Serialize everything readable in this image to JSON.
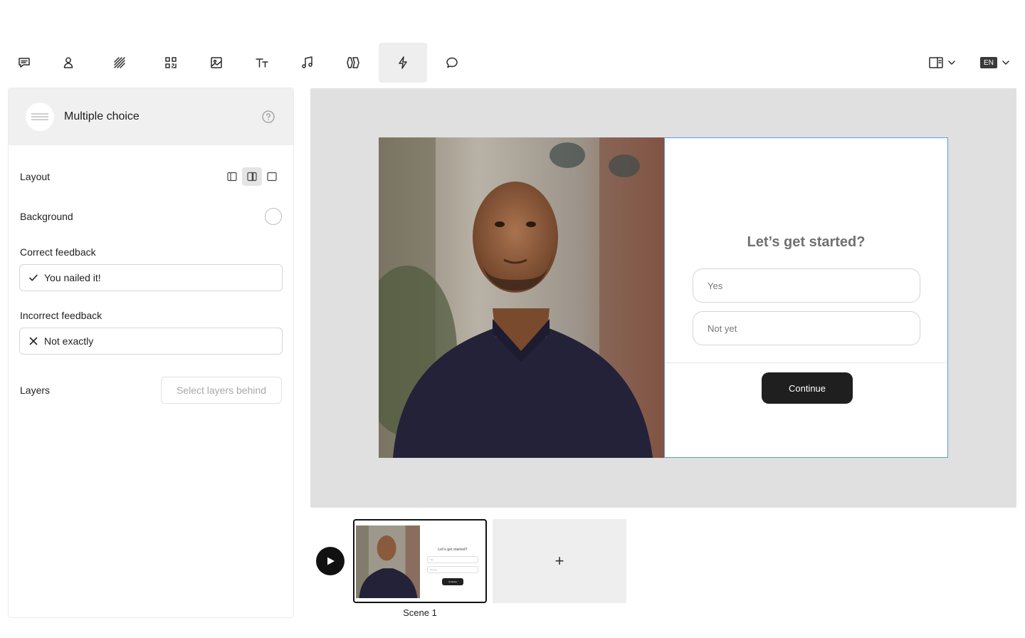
{
  "toolbar": {
    "tools": [
      "comment-lines-icon",
      "person-icon",
      "stripes-icon",
      "qr-code-icon",
      "image-icon",
      "text-size-icon",
      "music-note-icon",
      "chevrons-icon",
      "lightning-icon",
      "speech-bubble-icon"
    ],
    "active_tool": "lightning-icon",
    "language": "EN"
  },
  "panel": {
    "title": "Multiple choice",
    "layout_label": "Layout",
    "background_label": "Background",
    "background_color": "#ffffff",
    "correct_feedback_label": "Correct feedback",
    "correct_feedback_value": "You nailed it!",
    "incorrect_feedback_label": "Incorrect feedback",
    "incorrect_feedback_value": "Not exactly",
    "layers_label": "Layers",
    "layers_placeholder": "Select layers behind"
  },
  "scene": {
    "question": "Let’s get started?",
    "answers": [
      "Yes",
      "Not yet"
    ],
    "continue_label": "Continue"
  },
  "timeline": {
    "scene_label": "Scene 1",
    "add_label": "+"
  },
  "colors": {
    "accent_selection": "#5b9be6",
    "canvas_bg": "#e0e0e0",
    "button_dark": "#1f1f1f"
  }
}
